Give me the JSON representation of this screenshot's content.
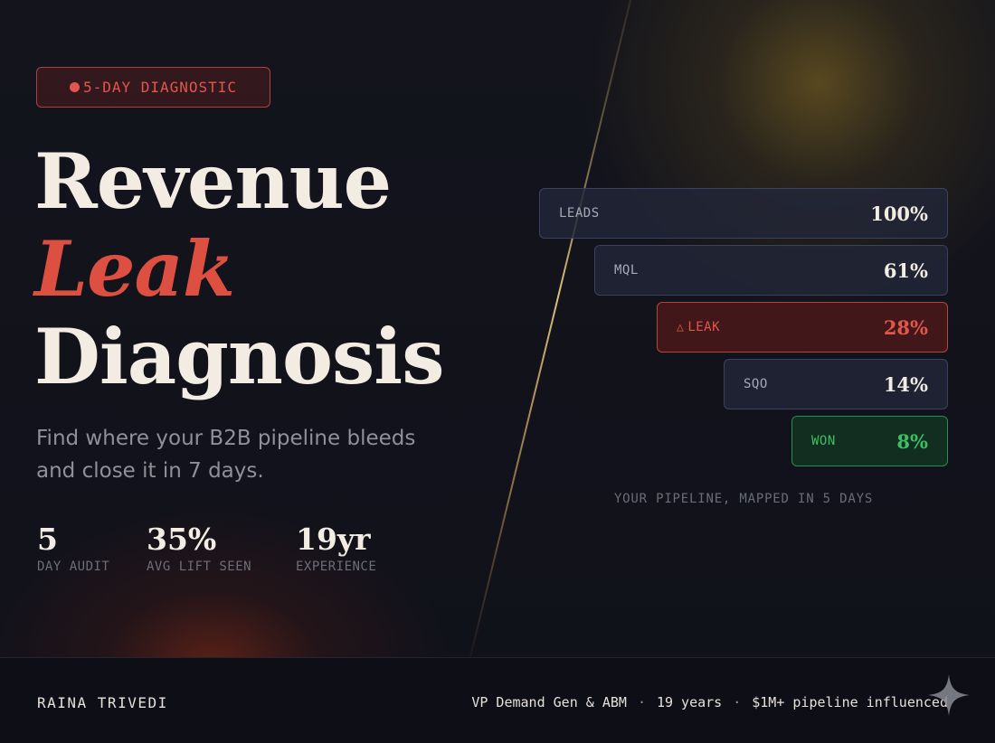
{
  "badge": {
    "dot_icon": "dot-icon",
    "label": "5-DAY DIAGNOSTIC"
  },
  "title": {
    "line1": "Revenue",
    "line2": "Leak",
    "line3": "Diagnosis"
  },
  "subtitle": "Find where your B2B pipeline bleeds and close it in 7 days.",
  "stats": [
    {
      "value": "5",
      "label": "DAY AUDIT"
    },
    {
      "value": "35%",
      "label": "AVG LIFT SEEN"
    },
    {
      "value": "19yr",
      "label": "EXPERIENCE"
    }
  ],
  "funnel": {
    "stages": [
      {
        "label": "LEADS",
        "value": "100%",
        "share": 1.0
      },
      {
        "label": "MQL",
        "value": "61%",
        "share": 0.61
      },
      {
        "label": "LEAK",
        "value": "28%",
        "share": 0.28,
        "icon": "warning-triangle-icon"
      },
      {
        "label": "SQO",
        "value": "14%",
        "share": 0.14
      },
      {
        "label": "WON",
        "value": "8%",
        "share": 0.08
      }
    ],
    "caption": "YOUR PIPELINE, MAPPED IN 5 DAYS"
  },
  "footer": {
    "author": "RAINA TRIVEDI",
    "role": "VP Demand Gen & ABM",
    "years": "19 years",
    "pipeline": "$1M+ pipeline influenced",
    "separator": "·"
  },
  "colors": {
    "accent_red": "#e2574c",
    "success_green": "#3fbf62",
    "background": "#11121a",
    "text_light": "#f2ece3"
  }
}
